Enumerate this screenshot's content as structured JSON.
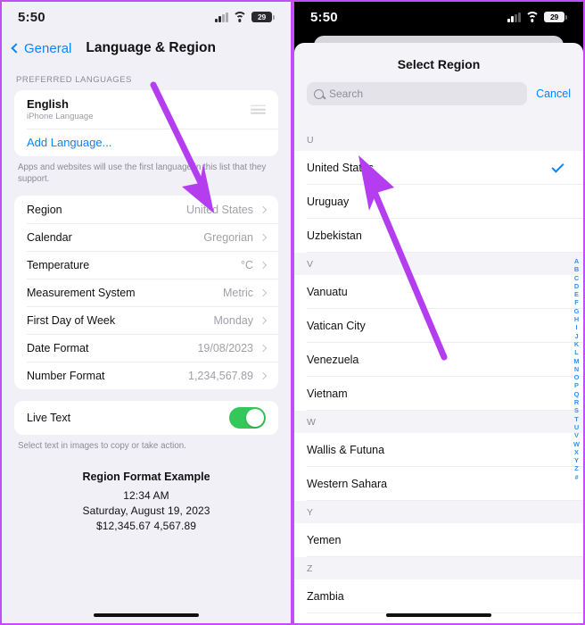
{
  "accent_colors": {
    "annotation_purple": "#b53df0",
    "ios_blue": "#0a84ff",
    "toggle_green": "#34c759",
    "sheet_gray": "#f4f3f7"
  },
  "left_panel": {
    "status_bar": {
      "time": "5:50",
      "battery": "29",
      "wifi_icon": "wifi-icon",
      "signal_icon": "cellular-signal-icon",
      "battery_icon": "battery-icon"
    },
    "nav": {
      "back_label": "General",
      "back_icon": "chevron-left-icon",
      "title": "Language & Region"
    },
    "preferred_languages": {
      "header": "PREFERRED LANGUAGES",
      "language": {
        "name": "English",
        "subtitle": "iPhone Language",
        "reorder_icon": "reorder-handle-icon"
      },
      "add_language": "Add Language...",
      "footnote": "Apps and websites will use the first language in this list that they support."
    },
    "settings_rows": [
      {
        "label": "Region",
        "value": "United States"
      },
      {
        "label": "Calendar",
        "value": "Gregorian"
      },
      {
        "label": "Temperature",
        "value": "°C"
      },
      {
        "label": "Measurement System",
        "value": "Metric"
      },
      {
        "label": "First Day of Week",
        "value": "Monday"
      },
      {
        "label": "Date Format",
        "value": "19/08/2023"
      },
      {
        "label": "Number Format",
        "value": "1,234,567.89"
      }
    ],
    "live_text": {
      "label": "Live Text",
      "enabled": true,
      "footnote": "Select text in images to copy or take action."
    },
    "region_example": {
      "title": "Region Format Example",
      "time": "12:34 AM",
      "date": "Saturday, August 19, 2023",
      "numbers": "$12,345.67    4,567.89"
    }
  },
  "right_panel": {
    "status_bar": {
      "time": "5:50",
      "battery": "29",
      "wifi_icon": "wifi-icon",
      "signal_icon": "cellular-signal-icon",
      "battery_icon": "battery-icon"
    },
    "sheet": {
      "title": "Select Region",
      "search": {
        "placeholder": "Search",
        "value": "",
        "search_icon": "search-icon",
        "mic_icon": "microphone-icon"
      },
      "cancel": "Cancel"
    },
    "list": [
      {
        "type": "section",
        "label": "U"
      },
      {
        "type": "item",
        "label": "United States",
        "selected": true
      },
      {
        "type": "item",
        "label": "Uruguay",
        "selected": false
      },
      {
        "type": "item",
        "label": "Uzbekistan",
        "selected": false
      },
      {
        "type": "section",
        "label": "V"
      },
      {
        "type": "item",
        "label": "Vanuatu",
        "selected": false
      },
      {
        "type": "item",
        "label": "Vatican City",
        "selected": false
      },
      {
        "type": "item",
        "label": "Venezuela",
        "selected": false
      },
      {
        "type": "item",
        "label": "Vietnam",
        "selected": false
      },
      {
        "type": "section",
        "label": "W"
      },
      {
        "type": "item",
        "label": "Wallis & Futuna",
        "selected": false
      },
      {
        "type": "item",
        "label": "Western Sahara",
        "selected": false
      },
      {
        "type": "section",
        "label": "Y"
      },
      {
        "type": "item",
        "label": "Yemen",
        "selected": false
      },
      {
        "type": "section",
        "label": "Z"
      },
      {
        "type": "item",
        "label": "Zambia",
        "selected": false
      }
    ],
    "index_letters": [
      "A",
      "B",
      "C",
      "D",
      "E",
      "F",
      "G",
      "H",
      "I",
      "J",
      "K",
      "L",
      "M",
      "N",
      "O",
      "P",
      "Q",
      "R",
      "S",
      "T",
      "U",
      "V",
      "W",
      "X",
      "Y",
      "Z",
      "#"
    ]
  },
  "annotations": [
    {
      "name": "arrow-to-region-value",
      "panel": "left",
      "target": "United States"
    },
    {
      "name": "arrow-to-united-states-row",
      "panel": "right",
      "target": "United States"
    }
  ]
}
